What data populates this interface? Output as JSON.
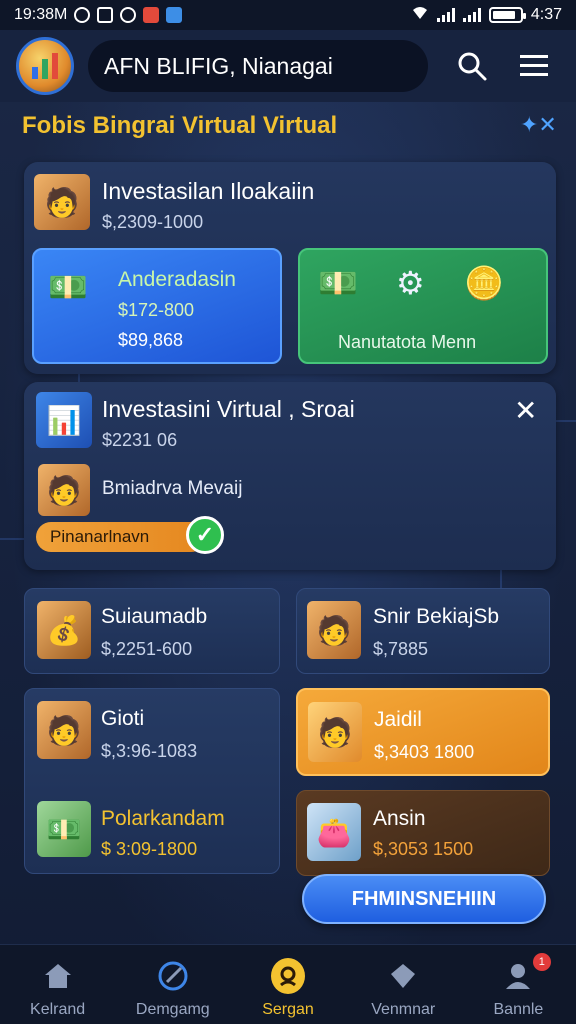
{
  "status_bar": {
    "time": "19:38M",
    "clock": "4:37"
  },
  "header": {
    "app_title": "AFN BLIFIG, Nianagai"
  },
  "section": {
    "title": "Fobis Bingrai Virtual Virtual"
  },
  "card_top": {
    "title": "Investasilan Iloakaiin",
    "subtitle": "$,2309-1000"
  },
  "tile_blue": {
    "title": "Anderadasin",
    "line1": "$172-800",
    "line2": "$89,868"
  },
  "tile_green": {
    "caption": "Nanutatota Menn"
  },
  "card_mid": {
    "title": "Investasini Virtual , Sroai",
    "subtitle": "$2231 06",
    "row_label": "Bmiadrva Mevaij",
    "progress_label": "Pinanarlnavn"
  },
  "grid": [
    {
      "title": "Suiaumadb",
      "value": "$,2251-600"
    },
    {
      "title": "Snir BekiajSb",
      "value": "$,7885"
    },
    {
      "title": "Gioti",
      "value": "$,3:96-1083"
    },
    {
      "title": "Jaidil",
      "value": "$,3403 1800"
    },
    {
      "title": "Polarkandam",
      "value": "$ 3:09-1800"
    },
    {
      "title": "Ansin",
      "value": "$,3053 1500"
    }
  ],
  "cta": {
    "label": "FHMINSNEHIIN"
  },
  "nav": [
    {
      "label": "Kelrand"
    },
    {
      "label": "Demgamg"
    },
    {
      "label": "Sergan"
    },
    {
      "label": "Venmnar"
    },
    {
      "label": "Bannle",
      "badge": "1"
    }
  ],
  "colors": {
    "accent": "#f3c230",
    "primary": "#2f6fe8",
    "success": "#2fa560",
    "warning": "#f5a93a"
  },
  "battery_level": 0.85
}
